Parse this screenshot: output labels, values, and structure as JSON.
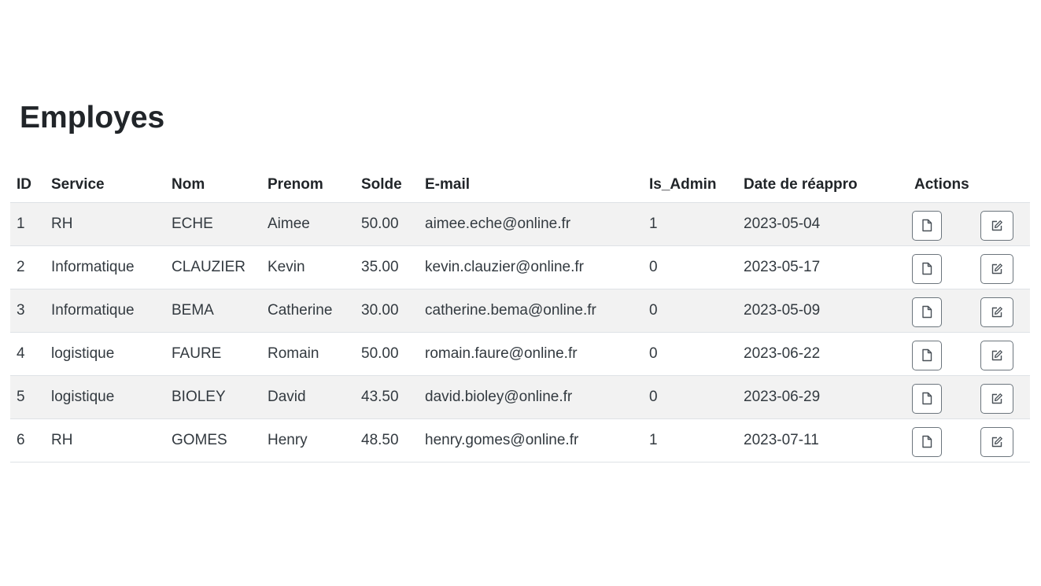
{
  "page": {
    "title": "Employes"
  },
  "table": {
    "headers": {
      "id": "ID",
      "service": "Service",
      "nom": "Nom",
      "prenom": "Prenom",
      "solde": "Solde",
      "email": "E-mail",
      "is_admin": "Is_Admin",
      "date": "Date de réappro",
      "actions": "Actions"
    },
    "rows": [
      {
        "id": "1",
        "service": "RH",
        "nom": "ECHE",
        "prenom": "Aimee",
        "solde": "50.00",
        "email": "aimee.eche@online.fr",
        "is_admin": "1",
        "date": "2023-05-04"
      },
      {
        "id": "2",
        "service": "Informatique",
        "nom": "CLAUZIER",
        "prenom": "Kevin",
        "solde": "35.00",
        "email": "kevin.clauzier@online.fr",
        "is_admin": "0",
        "date": "2023-05-17"
      },
      {
        "id": "3",
        "service": "Informatique",
        "nom": "BEMA",
        "prenom": "Catherine",
        "solde": "30.00",
        "email": "catherine.bema@online.fr",
        "is_admin": "0",
        "date": "2023-05-09"
      },
      {
        "id": "4",
        "service": "logistique",
        "nom": "FAURE",
        "prenom": "Romain",
        "solde": "50.00",
        "email": "romain.faure@online.fr",
        "is_admin": "0",
        "date": "2023-06-22"
      },
      {
        "id": "5",
        "service": "logistique",
        "nom": "BIOLEY",
        "prenom": "David",
        "solde": "43.50",
        "email": "david.bioley@online.fr",
        "is_admin": "0",
        "date": "2023-06-29"
      },
      {
        "id": "6",
        "service": "RH",
        "nom": "GOMES",
        "prenom": "Henry",
        "solde": "48.50",
        "email": "henry.gomes@online.fr",
        "is_admin": "1",
        "date": "2023-07-11"
      }
    ],
    "row_actions": [
      {
        "name": "view-button",
        "icon": "document-icon"
      },
      {
        "name": "edit-button",
        "icon": "edit-icon"
      }
    ]
  },
  "colors": {
    "stripe": "#f2f2f2",
    "border": "#dee2e6",
    "button_border": "#6c757d",
    "text": "#212529"
  }
}
